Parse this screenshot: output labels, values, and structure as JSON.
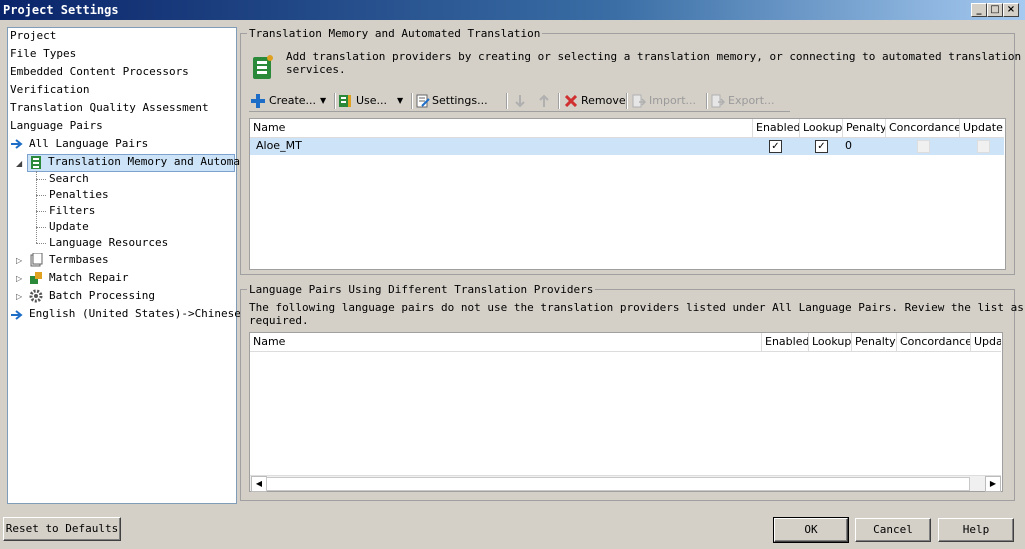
{
  "window": {
    "title": "Project Settings",
    "minimize_label": "_",
    "maximize_label": "□",
    "close_label": "×"
  },
  "tree": {
    "items": [
      {
        "label": "Project"
      },
      {
        "label": "File Types"
      },
      {
        "label": "Embedded Content Processors"
      },
      {
        "label": "Verification"
      },
      {
        "label": "Translation Quality Assessment"
      },
      {
        "label": "Language Pairs"
      },
      {
        "label": "All Language Pairs"
      },
      {
        "label": "Translation Memory and Automa"
      },
      {
        "label": "Search"
      },
      {
        "label": "Penalties"
      },
      {
        "label": "Filters"
      },
      {
        "label": "Update"
      },
      {
        "label": "Language Resources"
      },
      {
        "label": "Termbases"
      },
      {
        "label": "Match Repair"
      },
      {
        "label": "Batch Processing"
      },
      {
        "label": "English (United States)->Chinese"
      }
    ]
  },
  "tm_section": {
    "title": "Translation Memory and Automated Translation",
    "description_line1": "Add translation providers by creating or selecting a translation memory, or connecting to automated translation",
    "description_line2": "services."
  },
  "toolbar": {
    "create_label": "Create...",
    "use_label": "Use...",
    "settings_label": "Settings...",
    "move_down_icon": "arrow-down",
    "move_up_icon": "arrow-up",
    "remove_label": "Remove",
    "import_label": "Import...",
    "export_label": "Export..."
  },
  "tm_grid": {
    "columns": [
      "Name",
      "Enabled",
      "Lookup",
      "Penalty",
      "Concordance",
      "Update"
    ],
    "rows": [
      {
        "name": "Aloe_MT",
        "enabled": true,
        "lookup": true,
        "penalty": "0",
        "concordance": false,
        "update": false
      }
    ]
  },
  "lp_section": {
    "title": "Language Pairs Using Different Translation Providers",
    "description_line1": "The following language pairs do not use the translation providers listed under All Language Pairs. Review the list as",
    "description_line2": "required."
  },
  "lp_grid": {
    "columns": [
      "Name",
      "Enabled",
      "Lookup",
      "Penalty",
      "Concordance",
      "Upda"
    ]
  },
  "buttons": {
    "reset": "Reset to Defaults",
    "ok": "OK",
    "cancel": "Cancel",
    "help": "Help"
  },
  "colors": {
    "title_bar": "#0a246a",
    "selection": "#cde3f7",
    "accent_blue": "#1e6ec8",
    "remove_red": "#d03030",
    "tm_green": "#2a8a3a"
  }
}
